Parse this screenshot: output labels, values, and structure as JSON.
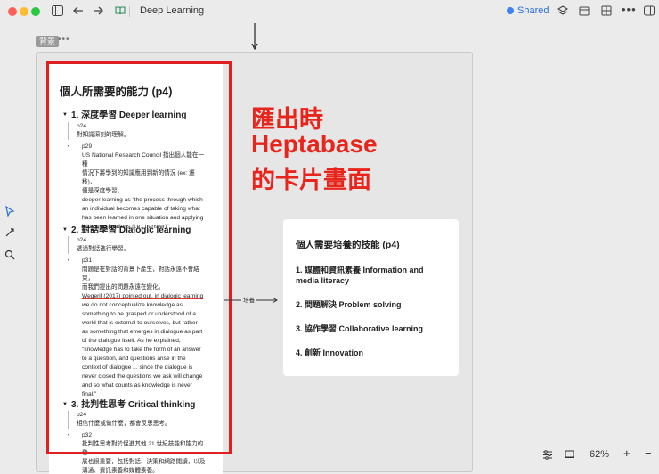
{
  "window": {
    "title": "Deep Learning",
    "shared_label": "Shared"
  },
  "section": {
    "tag": "背景",
    "more": "•••"
  },
  "annotation": {
    "line1": "匯出時",
    "line2": "Heptabase",
    "line3": "的卡片畫面"
  },
  "left_card": {
    "title": "個人所需要的能力 (p4)",
    "sections": [
      {
        "heading": "1. 深度學習 Deeper learning",
        "quote_page": "p24",
        "quote_text": "對知識深刻的理解。",
        "sub_page": "p29",
        "sub_lines": [
          "US National Research Council 指出個人能在一種",
          "情況下將學到的知識應用到新的情況 (ex: 遷移)，",
          "便是深度學習。",
          "deeper learning as \"the process through which",
          "an individual becomes capable of taking what",
          "has been learned in one situation and applying",
          "it to new situations (i.e., transfer)\""
        ]
      },
      {
        "heading": "2. 對話學習 Dialogic learning",
        "quote_page": "p24",
        "quote_text": "透過對話進行學習。",
        "sub_page": "p31",
        "sub_lines": [
          "問題是在對話的背景下產生，對話永遠不會結束，",
          "而我們提出的問題永遠在變化。",
          "Wegerif (2017) pointed out, in dialogic learning",
          "we do not conceptualize knowledge as",
          "something to be grasped or understood of a",
          "world that is external to ourselves, but rather",
          "as something that emerges in dialogue as part",
          "of the dialogue itself. As he explained,",
          "\"knowledge has to take the form of an answer",
          "to a question, and questions arise in the",
          "context of dialogue ... since the dialogue is",
          "never closed the questions we ask will change",
          "and so what counts as knowledge is never",
          "final.\""
        ]
      },
      {
        "heading": "3. 批判性思考 Critical thinking",
        "quote_page": "p24",
        "quote_text": "相信什麼或做什麼，都會反思思考。",
        "sub_page": "p32",
        "sub_lines": [
          "批判性思考對於促進其他 21 世紀技能和能力的發",
          "展也很重要，包括對話、決策和網路閱讀，以及",
          "溝通、資訊素養和媒體素養。"
        ]
      }
    ]
  },
  "connector": {
    "label": "培養"
  },
  "right_card": {
    "title": "個人需要培養的技能 (p4)",
    "items": [
      "1. 媒體和資訊素養 Information and media literacy",
      "2. 問題解決 Problem solving",
      "3. 協作學習 Collaborative learning",
      "4. 創新 Innovation"
    ]
  },
  "zoom": {
    "level": "62%",
    "minus": "−",
    "plus": "+"
  },
  "icons": [
    "sidebar-toggle-icon",
    "back-arrow-icon",
    "forward-arrow-icon",
    "book-icon",
    "layers-icon",
    "calendar-icon",
    "grid-icon",
    "more-icon",
    "panel-icon",
    "select-arrow-icon",
    "pen-icon",
    "search-icon",
    "settings-icon",
    "card-icon"
  ]
}
